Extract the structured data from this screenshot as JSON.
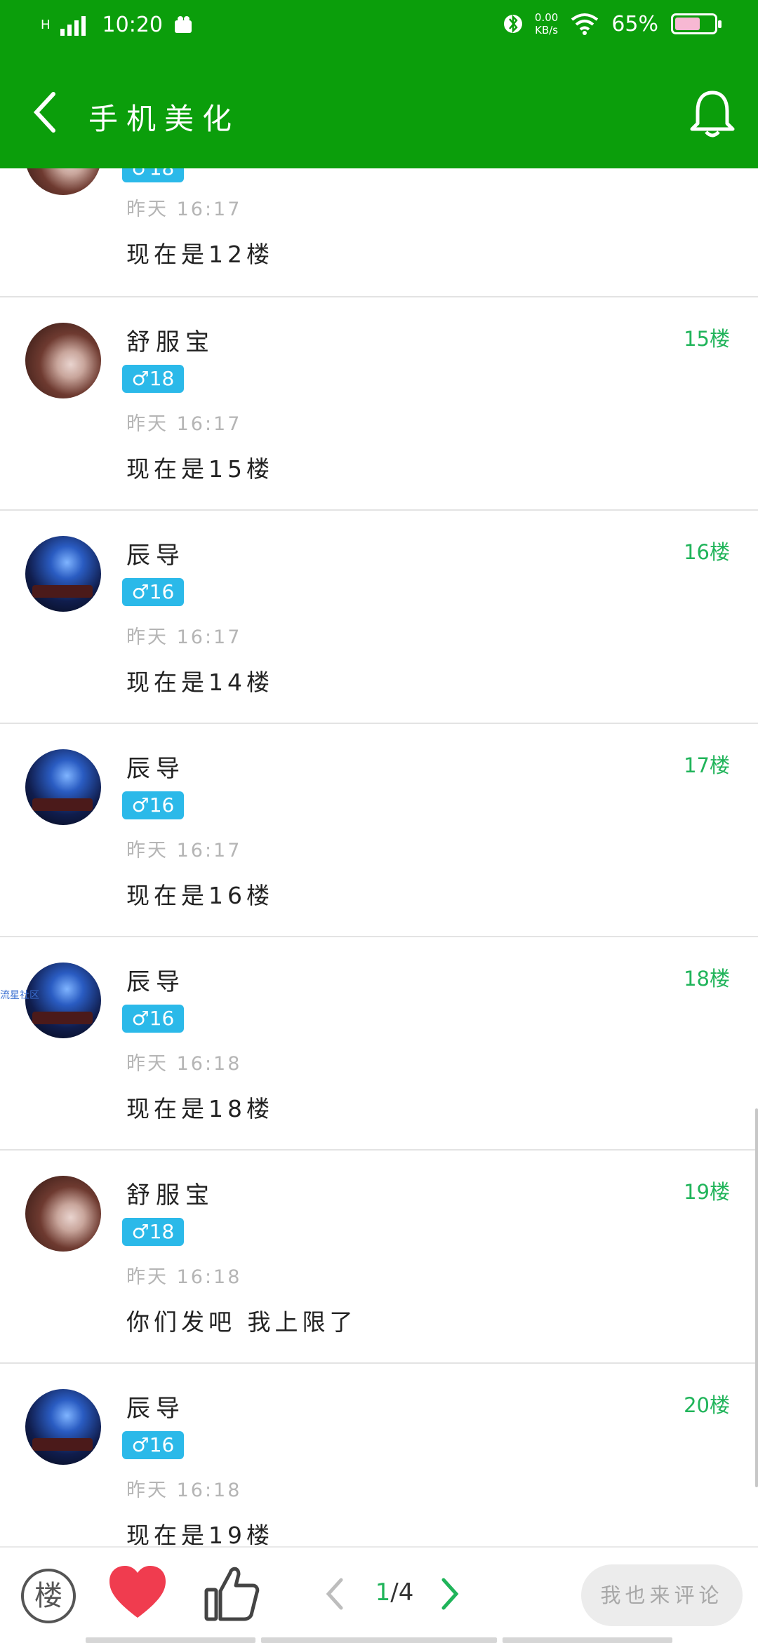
{
  "status_bar": {
    "time": "10:20",
    "network": "H",
    "speed_value": "0.00",
    "speed_unit": "KB/s",
    "battery": "65%",
    "battery_level": 0.65
  },
  "app_bar": {
    "title": "手机美化"
  },
  "partial_post": {
    "time": "昨天 16:17",
    "content": "现在是12楼"
  },
  "posts": [
    {
      "name": "舒服宝",
      "badge": "♂18",
      "time": "昨天 16:17",
      "content": "现在是15楼",
      "floor": "15楼",
      "avatar": "girl"
    },
    {
      "name": "辰导",
      "badge": "♂16",
      "time": "昨天 16:17",
      "content": "现在是14楼",
      "floor": "16楼",
      "avatar": "night"
    },
    {
      "name": "辰导",
      "badge": "♂16",
      "time": "昨天 16:17",
      "content": "现在是16楼",
      "floor": "17楼",
      "avatar": "night"
    },
    {
      "name": "辰导",
      "badge": "♂16",
      "time": "昨天 16:18",
      "content": "现在是18楼",
      "floor": "18楼",
      "avatar": "night"
    },
    {
      "name": "舒服宝",
      "badge": "♂18",
      "time": "昨天 16:18",
      "content": "你们发吧 我上限了",
      "floor": "19楼",
      "avatar": "girl"
    },
    {
      "name": "辰导",
      "badge": "♂16",
      "time": "昨天 16:18",
      "content": "现在是19楼",
      "floor": "20楼",
      "avatar": "night"
    }
  ],
  "watermark": "流星社区",
  "bottom_bar": {
    "floor_icon_label": "楼",
    "page_current": "1",
    "page_total": "/4",
    "comment_placeholder": "我也来评论"
  },
  "colors": {
    "header": "#0b9e0b",
    "floor": "#20b45a",
    "badge": "#2bb9e9",
    "heart": "#f03c4f"
  }
}
